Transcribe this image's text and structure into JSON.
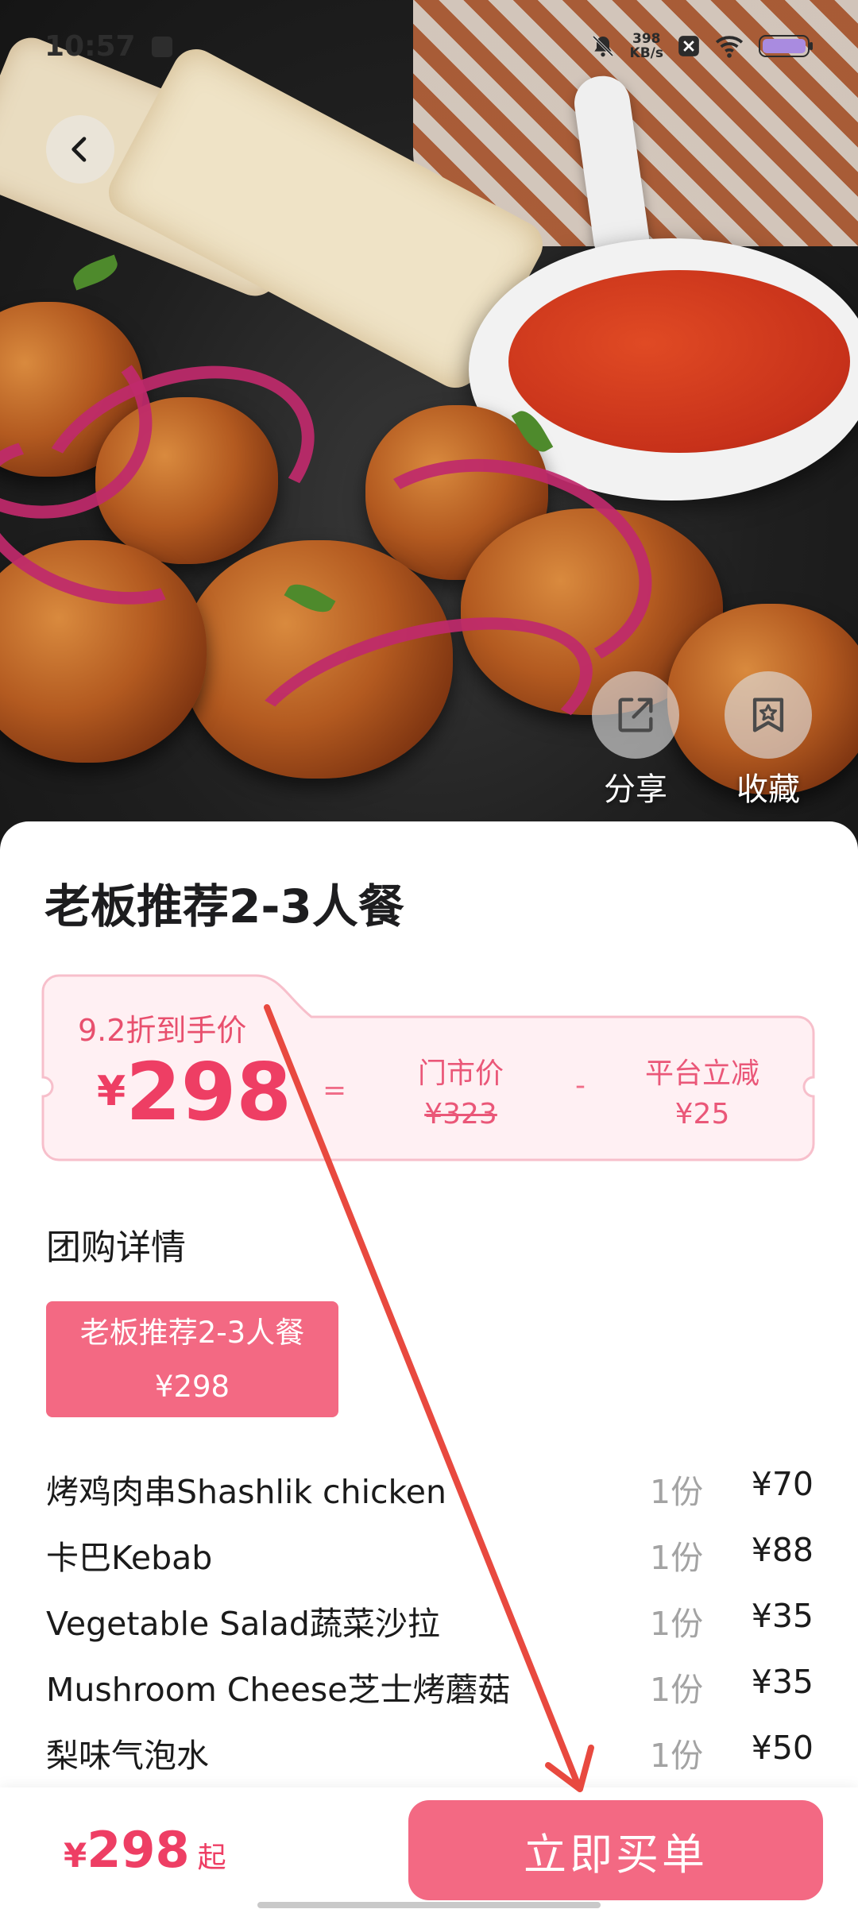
{
  "status_bar": {
    "time": "10:57",
    "net_speed_value": "398",
    "net_speed_unit": "KB/s",
    "icons": [
      "message-icon",
      "mute-bell-icon",
      "x-app-icon",
      "wifi-icon",
      "battery-icon"
    ]
  },
  "hero": {
    "share_label": "分享",
    "favorite_label": "收藏"
  },
  "product": {
    "title": "老板推荐2-3人餐"
  },
  "price_box": {
    "discount_label": "9.2折到手价",
    "currency": "¥",
    "final_price": "298",
    "equals": "=",
    "market_label": "门市价",
    "market_price": "¥323",
    "minus": "-",
    "reduction_label": "平台立减",
    "reduction_amount": "¥25"
  },
  "details": {
    "section_title": "团购详情",
    "package_name": "老板推荐2-3人餐",
    "package_price": "¥298",
    "items": [
      {
        "name": "烤鸡肉串Shashlik chicken",
        "qty": "1份",
        "price": "¥70"
      },
      {
        "name": "卡巴Kebab",
        "qty": "1份",
        "price": "¥88"
      },
      {
        "name": "Vegetable Salad蔬菜沙拉",
        "qty": "1份",
        "price": "¥35"
      },
      {
        "name": "Mushroom Cheese芝士烤蘑菇",
        "qty": "1份",
        "price": "¥35"
      },
      {
        "name": "梨味气泡水",
        "qty": "1份",
        "price": "¥50"
      }
    ]
  },
  "bottom_bar": {
    "currency": "¥",
    "price": "298",
    "suffix": "起",
    "buy_label": "立即买单"
  },
  "colors": {
    "accent": "#f36983",
    "price_red": "#ee3e64",
    "price_box_bg": "#fff0f3",
    "price_box_border": "#f7bfcb",
    "annotation_arrow": "#e8493f"
  }
}
